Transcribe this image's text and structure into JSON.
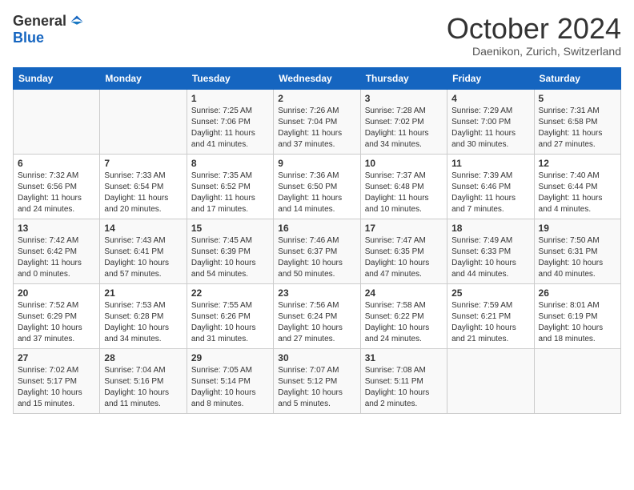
{
  "logo": {
    "general": "General",
    "blue": "Blue"
  },
  "title": "October 2024",
  "location": "Daenikon, Zurich, Switzerland",
  "days_of_week": [
    "Sunday",
    "Monday",
    "Tuesday",
    "Wednesday",
    "Thursday",
    "Friday",
    "Saturday"
  ],
  "weeks": [
    [
      {
        "day": "",
        "sunrise": "",
        "sunset": "",
        "daylight": ""
      },
      {
        "day": "",
        "sunrise": "",
        "sunset": "",
        "daylight": ""
      },
      {
        "day": "1",
        "sunrise": "Sunrise: 7:25 AM",
        "sunset": "Sunset: 7:06 PM",
        "daylight": "Daylight: 11 hours and 41 minutes."
      },
      {
        "day": "2",
        "sunrise": "Sunrise: 7:26 AM",
        "sunset": "Sunset: 7:04 PM",
        "daylight": "Daylight: 11 hours and 37 minutes."
      },
      {
        "day": "3",
        "sunrise": "Sunrise: 7:28 AM",
        "sunset": "Sunset: 7:02 PM",
        "daylight": "Daylight: 11 hours and 34 minutes."
      },
      {
        "day": "4",
        "sunrise": "Sunrise: 7:29 AM",
        "sunset": "Sunset: 7:00 PM",
        "daylight": "Daylight: 11 hours and 30 minutes."
      },
      {
        "day": "5",
        "sunrise": "Sunrise: 7:31 AM",
        "sunset": "Sunset: 6:58 PM",
        "daylight": "Daylight: 11 hours and 27 minutes."
      }
    ],
    [
      {
        "day": "6",
        "sunrise": "Sunrise: 7:32 AM",
        "sunset": "Sunset: 6:56 PM",
        "daylight": "Daylight: 11 hours and 24 minutes."
      },
      {
        "day": "7",
        "sunrise": "Sunrise: 7:33 AM",
        "sunset": "Sunset: 6:54 PM",
        "daylight": "Daylight: 11 hours and 20 minutes."
      },
      {
        "day": "8",
        "sunrise": "Sunrise: 7:35 AM",
        "sunset": "Sunset: 6:52 PM",
        "daylight": "Daylight: 11 hours and 17 minutes."
      },
      {
        "day": "9",
        "sunrise": "Sunrise: 7:36 AM",
        "sunset": "Sunset: 6:50 PM",
        "daylight": "Daylight: 11 hours and 14 minutes."
      },
      {
        "day": "10",
        "sunrise": "Sunrise: 7:37 AM",
        "sunset": "Sunset: 6:48 PM",
        "daylight": "Daylight: 11 hours and 10 minutes."
      },
      {
        "day": "11",
        "sunrise": "Sunrise: 7:39 AM",
        "sunset": "Sunset: 6:46 PM",
        "daylight": "Daylight: 11 hours and 7 minutes."
      },
      {
        "day": "12",
        "sunrise": "Sunrise: 7:40 AM",
        "sunset": "Sunset: 6:44 PM",
        "daylight": "Daylight: 11 hours and 4 minutes."
      }
    ],
    [
      {
        "day": "13",
        "sunrise": "Sunrise: 7:42 AM",
        "sunset": "Sunset: 6:42 PM",
        "daylight": "Daylight: 11 hours and 0 minutes."
      },
      {
        "day": "14",
        "sunrise": "Sunrise: 7:43 AM",
        "sunset": "Sunset: 6:41 PM",
        "daylight": "Daylight: 10 hours and 57 minutes."
      },
      {
        "day": "15",
        "sunrise": "Sunrise: 7:45 AM",
        "sunset": "Sunset: 6:39 PM",
        "daylight": "Daylight: 10 hours and 54 minutes."
      },
      {
        "day": "16",
        "sunrise": "Sunrise: 7:46 AM",
        "sunset": "Sunset: 6:37 PM",
        "daylight": "Daylight: 10 hours and 50 minutes."
      },
      {
        "day": "17",
        "sunrise": "Sunrise: 7:47 AM",
        "sunset": "Sunset: 6:35 PM",
        "daylight": "Daylight: 10 hours and 47 minutes."
      },
      {
        "day": "18",
        "sunrise": "Sunrise: 7:49 AM",
        "sunset": "Sunset: 6:33 PM",
        "daylight": "Daylight: 10 hours and 44 minutes."
      },
      {
        "day": "19",
        "sunrise": "Sunrise: 7:50 AM",
        "sunset": "Sunset: 6:31 PM",
        "daylight": "Daylight: 10 hours and 40 minutes."
      }
    ],
    [
      {
        "day": "20",
        "sunrise": "Sunrise: 7:52 AM",
        "sunset": "Sunset: 6:29 PM",
        "daylight": "Daylight: 10 hours and 37 minutes."
      },
      {
        "day": "21",
        "sunrise": "Sunrise: 7:53 AM",
        "sunset": "Sunset: 6:28 PM",
        "daylight": "Daylight: 10 hours and 34 minutes."
      },
      {
        "day": "22",
        "sunrise": "Sunrise: 7:55 AM",
        "sunset": "Sunset: 6:26 PM",
        "daylight": "Daylight: 10 hours and 31 minutes."
      },
      {
        "day": "23",
        "sunrise": "Sunrise: 7:56 AM",
        "sunset": "Sunset: 6:24 PM",
        "daylight": "Daylight: 10 hours and 27 minutes."
      },
      {
        "day": "24",
        "sunrise": "Sunrise: 7:58 AM",
        "sunset": "Sunset: 6:22 PM",
        "daylight": "Daylight: 10 hours and 24 minutes."
      },
      {
        "day": "25",
        "sunrise": "Sunrise: 7:59 AM",
        "sunset": "Sunset: 6:21 PM",
        "daylight": "Daylight: 10 hours and 21 minutes."
      },
      {
        "day": "26",
        "sunrise": "Sunrise: 8:01 AM",
        "sunset": "Sunset: 6:19 PM",
        "daylight": "Daylight: 10 hours and 18 minutes."
      }
    ],
    [
      {
        "day": "27",
        "sunrise": "Sunrise: 7:02 AM",
        "sunset": "Sunset: 5:17 PM",
        "daylight": "Daylight: 10 hours and 15 minutes."
      },
      {
        "day": "28",
        "sunrise": "Sunrise: 7:04 AM",
        "sunset": "Sunset: 5:16 PM",
        "daylight": "Daylight: 10 hours and 11 minutes."
      },
      {
        "day": "29",
        "sunrise": "Sunrise: 7:05 AM",
        "sunset": "Sunset: 5:14 PM",
        "daylight": "Daylight: 10 hours and 8 minutes."
      },
      {
        "day": "30",
        "sunrise": "Sunrise: 7:07 AM",
        "sunset": "Sunset: 5:12 PM",
        "daylight": "Daylight: 10 hours and 5 minutes."
      },
      {
        "day": "31",
        "sunrise": "Sunrise: 7:08 AM",
        "sunset": "Sunset: 5:11 PM",
        "daylight": "Daylight: 10 hours and 2 minutes."
      },
      {
        "day": "",
        "sunrise": "",
        "sunset": "",
        "daylight": ""
      },
      {
        "day": "",
        "sunrise": "",
        "sunset": "",
        "daylight": ""
      }
    ]
  ]
}
